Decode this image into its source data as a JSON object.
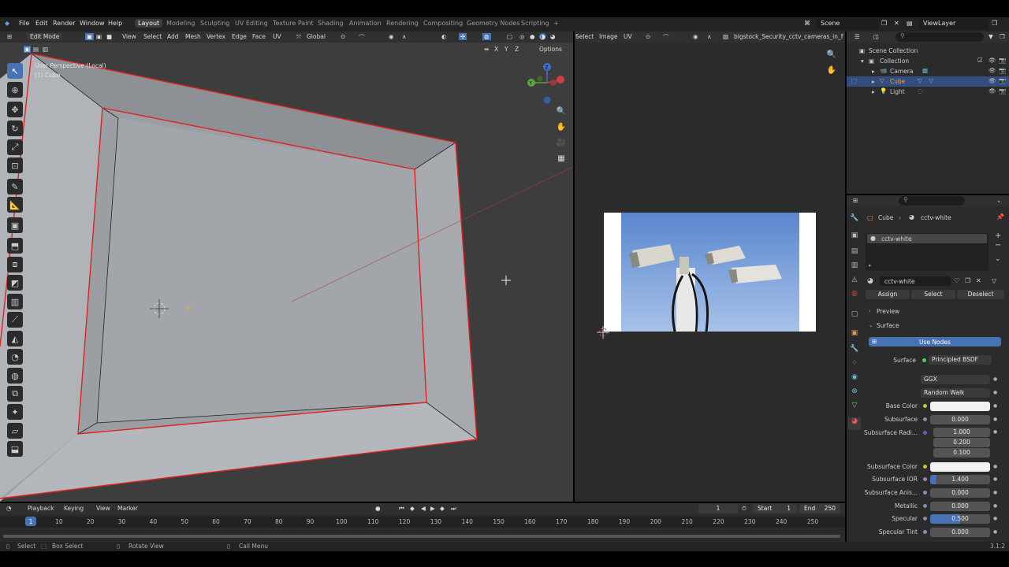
{
  "menu": {
    "file": "File",
    "edit": "Edit",
    "render": "Render",
    "window": "Window",
    "help": "Help"
  },
  "workspaces": [
    "Layout",
    "Modeling",
    "Sculpting",
    "UV Editing",
    "Texture Paint",
    "Shading",
    "Animation",
    "Rendering",
    "Compositing",
    "Geometry Nodes",
    "Scripting",
    "+"
  ],
  "scene": "Scene",
  "view_layer": "ViewLayer",
  "viewport": {
    "mode": "Edit Mode",
    "menus": [
      "View",
      "Select",
      "Add",
      "Mesh",
      "Vertex",
      "Edge",
      "Face",
      "UV"
    ],
    "orientation": "Global",
    "options": "Options",
    "axes": [
      "X",
      "Y",
      "Z"
    ],
    "overlay_title": "User Perspective (Local)",
    "overlay_object": "(1) Cube"
  },
  "image_editor": {
    "menus": [
      "Select",
      "Image",
      "UV"
    ],
    "image_name": "bigstock_Security_cctv_cameras_in_fr"
  },
  "outliner": {
    "root": "Scene Collection",
    "collection": "Collection",
    "items": [
      "Camera",
      "Cube",
      "Light"
    ]
  },
  "properties": {
    "breadcrumb_object": "Cube",
    "breadcrumb_material": "cctv-white",
    "slot_name": "cctv-white",
    "material_name": "cctv-white",
    "assign": "Assign",
    "select": "Select",
    "deselect": "Deselect",
    "preview": "Preview",
    "surface_panel": "Surface",
    "use_nodes": "Use Nodes",
    "surface_label": "Surface",
    "surface_value": "Principled BSDF",
    "distribution": "GGX",
    "sss_method": "Random Walk",
    "rows": [
      {
        "label": "Base Color",
        "value": ""
      },
      {
        "label": "Subsurface",
        "value": "0.000"
      },
      {
        "label": "Subsurface Radi...",
        "value": "1.000"
      },
      {
        "label": "",
        "value": "0.200"
      },
      {
        "label": "",
        "value": "0.100"
      },
      {
        "label": "Subsurface Color",
        "value": ""
      },
      {
        "label": "Subsurface IOR",
        "value": "1.400"
      },
      {
        "label": "Subsurface Anis...",
        "value": "0.000"
      },
      {
        "label": "Metallic",
        "value": "0.000"
      },
      {
        "label": "Specular",
        "value": "0.500"
      },
      {
        "label": "Specular Tint",
        "value": "0.000"
      }
    ]
  },
  "timeline": {
    "menus": [
      "Playback",
      "Keying",
      "View",
      "Marker"
    ],
    "current_frame": "1",
    "start_label": "Start",
    "start": "1",
    "end_label": "End",
    "end": "250",
    "ticks": [
      "1",
      "10",
      "20",
      "30",
      "40",
      "50",
      "60",
      "70",
      "80",
      "90",
      "100",
      "110",
      "120",
      "130",
      "140",
      "150",
      "160",
      "170",
      "180",
      "190",
      "200",
      "210",
      "220",
      "230",
      "240",
      "250"
    ]
  },
  "statusbar": {
    "select": "Select",
    "box_select": "Box Select",
    "rotate_view": "Rotate View",
    "call_menu": "Call Menu",
    "version": "3.1.2"
  },
  "colors": {
    "accent": "#4772b3",
    "selection_edge": "#e0221f",
    "active_object": "#f0a040"
  }
}
